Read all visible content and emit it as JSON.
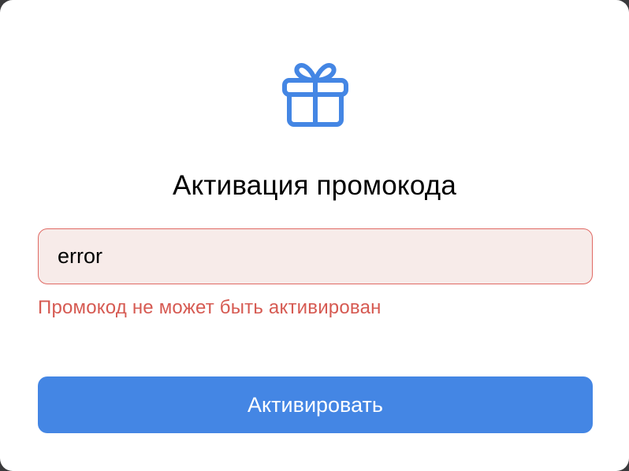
{
  "modal": {
    "icon": "gift-icon",
    "title": "Активация промокода",
    "promo_input": {
      "value": "error",
      "placeholder": ""
    },
    "error_message": "Промокод не может быть активирован",
    "activate_label": "Активировать"
  },
  "colors": {
    "accent": "#4486e4",
    "error": "#d65a52",
    "error_background": "#f7ebe9",
    "error_border": "#e06a64"
  }
}
